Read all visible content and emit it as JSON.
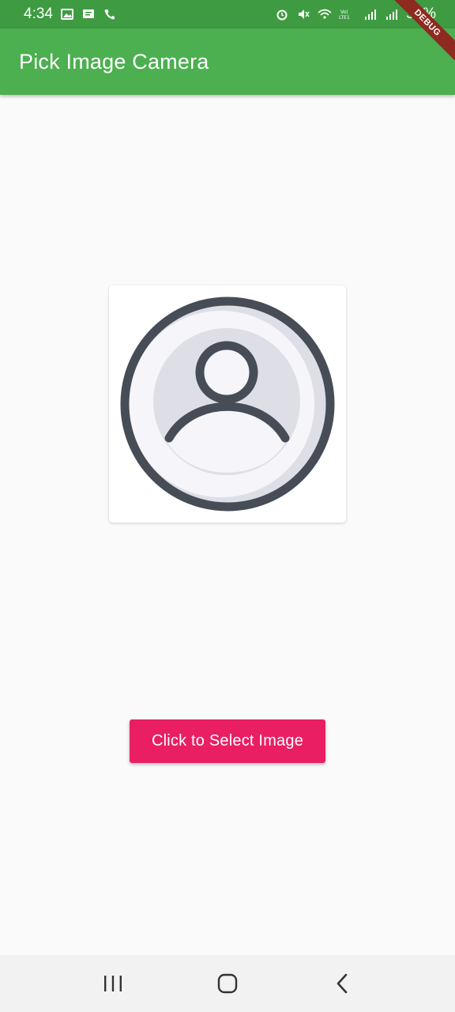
{
  "status_bar": {
    "time": "4:34",
    "battery": "58%",
    "left_icons": [
      "gallery-icon",
      "message-icon",
      "wifi-calling-icon"
    ],
    "right_icons": [
      "alarm-icon",
      "mute-icon",
      "wifi-icon",
      "volte-icon",
      "signal-icon",
      "signal-icon-2",
      "battery-icon"
    ]
  },
  "app_bar": {
    "title": "Pick Image Camera",
    "background": "#4caf50"
  },
  "debug_banner": {
    "label": "DEBUG"
  },
  "main": {
    "image_placeholder": "avatar-placeholder-icon",
    "select_button_label": "Click to Select Image",
    "button_color": "#e91e63"
  },
  "nav_bar": {
    "items": [
      "recents-icon",
      "home-icon",
      "back-icon"
    ]
  }
}
